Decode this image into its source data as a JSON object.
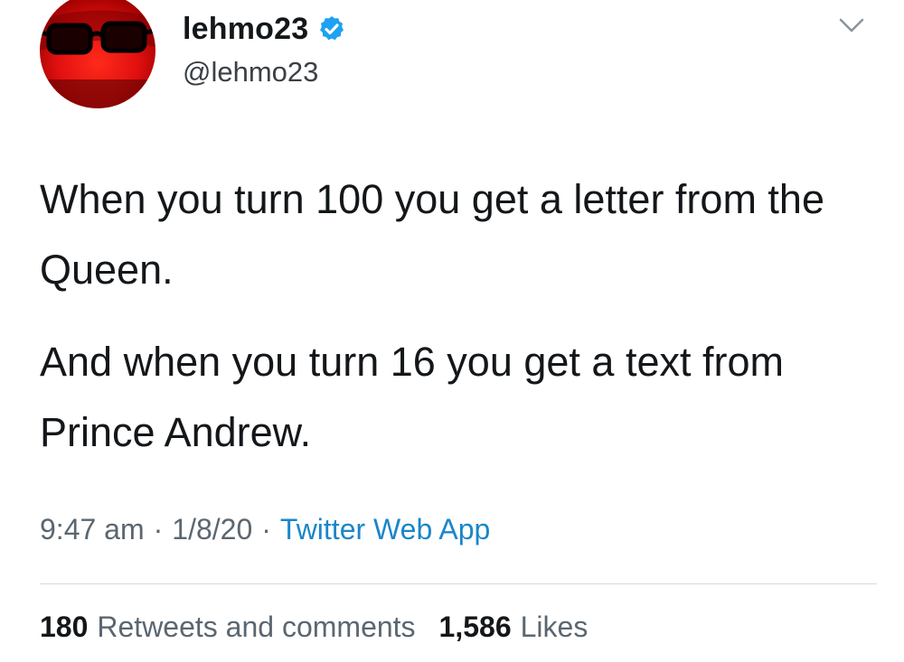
{
  "user": {
    "display_name": "lehmo23",
    "handle": "@lehmo23",
    "verified": true,
    "verified_color": "#1da1f2"
  },
  "tweet": {
    "paragraphs": [
      "When you turn 100 you get a letter from the Queen.",
      "And when you turn 16 you get a text from Prince Andrew."
    ]
  },
  "meta": {
    "time": "9:47 am",
    "separator": "·",
    "date": "1/8/20",
    "source": "Twitter Web App",
    "source_color": "#1b86c9"
  },
  "stats": {
    "retweets_count": "180",
    "retweets_label": "Retweets and comments",
    "likes_count": "1,586",
    "likes_label": "Likes"
  },
  "icons": {
    "verified": "verified-badge-icon",
    "menu": "chevron-down-icon",
    "avatar": "glasses-icon"
  }
}
